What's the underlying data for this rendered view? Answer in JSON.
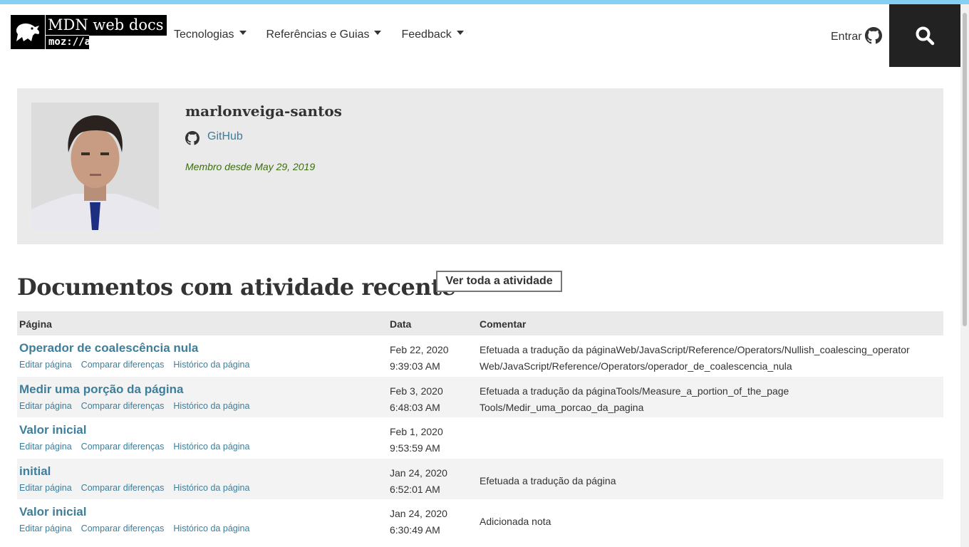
{
  "header": {
    "logo": {
      "line1": "MDN web docs",
      "line2": "moz://a"
    },
    "nav": [
      {
        "label": "Tecnologias"
      },
      {
        "label": "Referências e Guias"
      },
      {
        "label": "Feedback"
      }
    ],
    "signin_label": "Entrar"
  },
  "profile": {
    "username": "marlonveiga-santos",
    "github_label": "GitHub",
    "member_since": "Membro desde May 29, 2019"
  },
  "activity": {
    "title": "Documentos com atividade recente",
    "view_all_label": "Ver toda a atividade",
    "columns": {
      "page": "Página",
      "date": "Data",
      "comment": "Comentar"
    },
    "action_labels": {
      "edit": "Editar página",
      "compare": "Comparar diferenças",
      "history": "Histórico da página"
    },
    "rows": [
      {
        "title": "Operador de coalescência nula",
        "date": "Feb 22, 2020",
        "time": "9:39:03 AM",
        "comment1": "Efetuada a tradução da páginaWeb/JavaScript/Reference/Operators/Nullish_coalescing_operator",
        "comment2": "Web/JavaScript/Reference/Operators/operador_de_coalescencia_nula"
      },
      {
        "title": "Medir uma porção da página",
        "date": "Feb 3, 2020",
        "time": "6:48:03 AM",
        "comment1": "Efetuada a tradução da páginaTools/Measure_a_portion_of_the_page",
        "comment2": "Tools/Medir_uma_porcao_da_pagina"
      },
      {
        "title": "Valor inicial",
        "date": "Feb 1, 2020",
        "time": "9:53:59 AM",
        "comment1": "",
        "comment2": ""
      },
      {
        "title": "initial",
        "date": "Jan 24, 2020",
        "time": "6:52:01 AM",
        "comment1": "Efetuada a tradução da página",
        "comment2": ""
      },
      {
        "title": "Valor inicial",
        "date": "Jan 24, 2020",
        "time": "6:30:49 AM",
        "comment1": "Adicionada nota",
        "comment2": ""
      }
    ]
  },
  "colors": {
    "accent_bar": "#83d0f2",
    "link": "#3d7e9a",
    "member_text": "#3b6e0f",
    "search_bg": "#222222"
  },
  "icons": [
    "mdn-dino-logo",
    "caret-down-icon",
    "github-icon",
    "search-icon"
  ]
}
